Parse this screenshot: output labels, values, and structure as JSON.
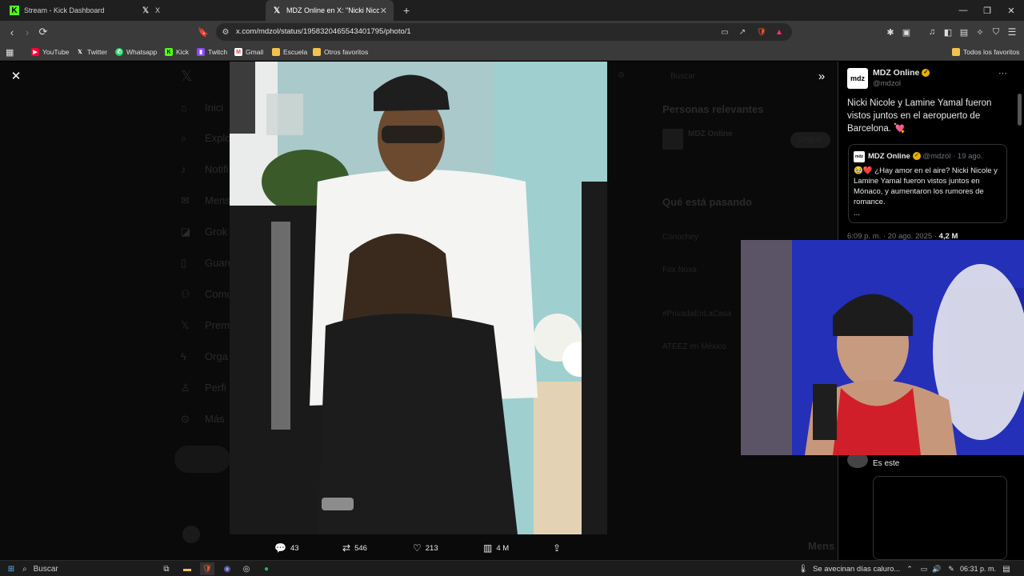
{
  "tabs": [
    {
      "title": "Stream - Kick Dashboard",
      "active": false
    },
    {
      "title": "X",
      "active": false
    },
    {
      "title": "MDZ Online en X: \"Nicki Nicole y",
      "active": true
    }
  ],
  "address_bar": {
    "url": "x.com/mdzol/status/1958320465543401795/photo/1"
  },
  "bookmarks": [
    {
      "label": "YouTube",
      "icon": "youtube-icon",
      "color": "#ff0033"
    },
    {
      "label": "Twitter",
      "icon": "x-icon",
      "color": "#000000"
    },
    {
      "label": "Whatsapp",
      "icon": "whatsapp-icon",
      "color": "#25d366"
    },
    {
      "label": "Kick",
      "icon": "kick-icon",
      "color": "#53fc18"
    },
    {
      "label": "Twitch",
      "icon": "twitch-icon",
      "color": "#9146ff"
    },
    {
      "label": "Gmail",
      "icon": "gmail-icon",
      "color": "#ea4335"
    },
    {
      "label": "Escuela",
      "icon": "folder-icon",
      "color": "#f2c14e"
    },
    {
      "label": "Otros favoritos",
      "icon": "folder-icon",
      "color": "#f2c14e"
    }
  ],
  "bookmarks_right": "Todos los favoritos",
  "background_page": {
    "nav": [
      "Inici",
      "Explo",
      "Notifi",
      "Mens",
      "Grok",
      "Guard",
      "Comu",
      "Prem",
      "Orga",
      "Perfi",
      "Más"
    ],
    "search_placeholder": "Buscar",
    "relevant_title": "Personas relevantes",
    "relevant_name": "MDZ Online",
    "relevant_follow": "Seguir",
    "trending_title": "Qué está pasando",
    "trends": [
      "Conochey",
      "Fox Noxa",
      "#PrivadaEnLaCasa",
      "ATEEZ en México"
    ],
    "messages_label": "Mens"
  },
  "actions": {
    "replies": "43",
    "reposts": "546",
    "likes": "213",
    "views": "4 M"
  },
  "tweet": {
    "author_name": "MDZ Online",
    "author_handle": "@mdzol",
    "avatar_text": "mdz",
    "text": "Nicki Nicole y Lamine Yamal fueron vistos juntos en el aeropuerto de Barcelona. 💘",
    "quote_author": "MDZ Online",
    "quote_handle": "@mdzol",
    "quote_date": "· 19 ago.",
    "quote_text": "🥹❤️ ¿Hay amor en el aire? Nicki Nicole y Lamine Yamal fueron vistos juntos en Mónaco, y aumentaron los rumores de romance.",
    "quote_more": "...",
    "timestamp": "6:09 p. m. · 20 ago. 2025 ·",
    "views": "4,2 M",
    "reply_text": "Es este"
  },
  "taskbar": {
    "search": "Buscar",
    "weather": "Se avecinan días caluro...",
    "time": "06:31 p. m."
  }
}
